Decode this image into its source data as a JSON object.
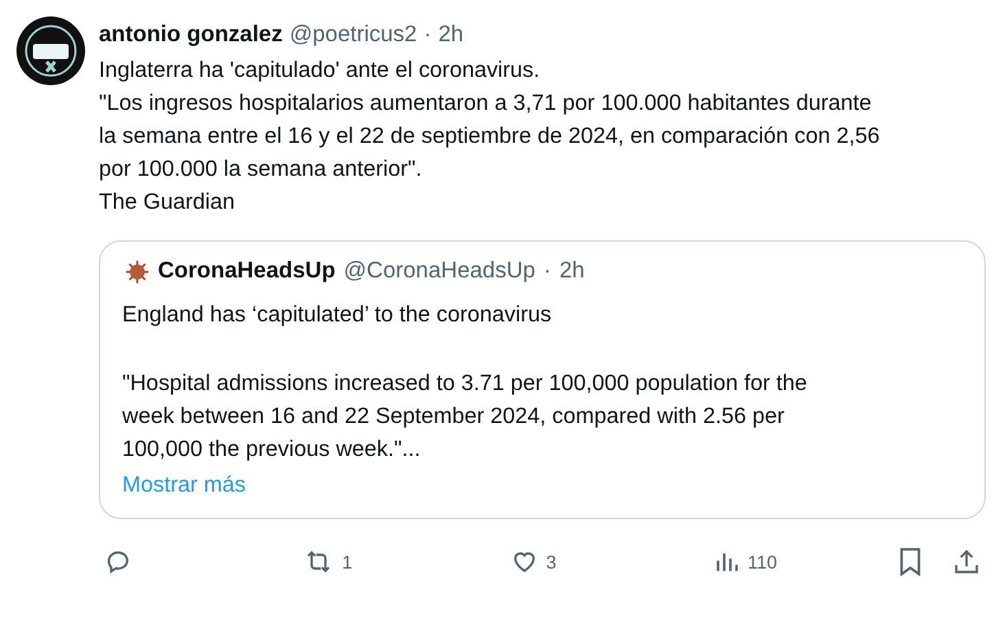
{
  "post": {
    "author": "antonio gonzalez",
    "handle": "@poetricus2",
    "separator": "·",
    "time": "2h",
    "text_lines": [
      "Inglaterra ha 'capitulado' ante el coronavirus.",
      "\"Los ingresos hospitalarios aumentaron a 3,71 por 100.000 habitantes durante",
      "la semana entre el 16 y el 22 de septiembre de 2024, en comparación con 2,56",
      "por 100.000 la semana anterior\".",
      "The Guardian"
    ]
  },
  "quote": {
    "author": "CoronaHeadsUp",
    "handle": "@CoronaHeadsUp",
    "separator": "·",
    "time": "2h",
    "title": "England has ‘capitulated’ to the coronavirus",
    "text_lines": [
      "\"Hospital admissions increased to 3.71 per 100,000 population for the",
      "week between 16 and 22 September 2024, compared with 2.56 per",
      "100,000 the previous week.\"..."
    ],
    "more_link": "Mostrar más"
  },
  "actions": [
    {
      "kind": "reply"
    },
    {
      "kind": "repost",
      "count": "1"
    },
    {
      "kind": "like",
      "count": "3"
    },
    {
      "kind": "views",
      "count": "110"
    },
    {
      "kind": "bookmark"
    },
    {
      "kind": "share"
    }
  ]
}
